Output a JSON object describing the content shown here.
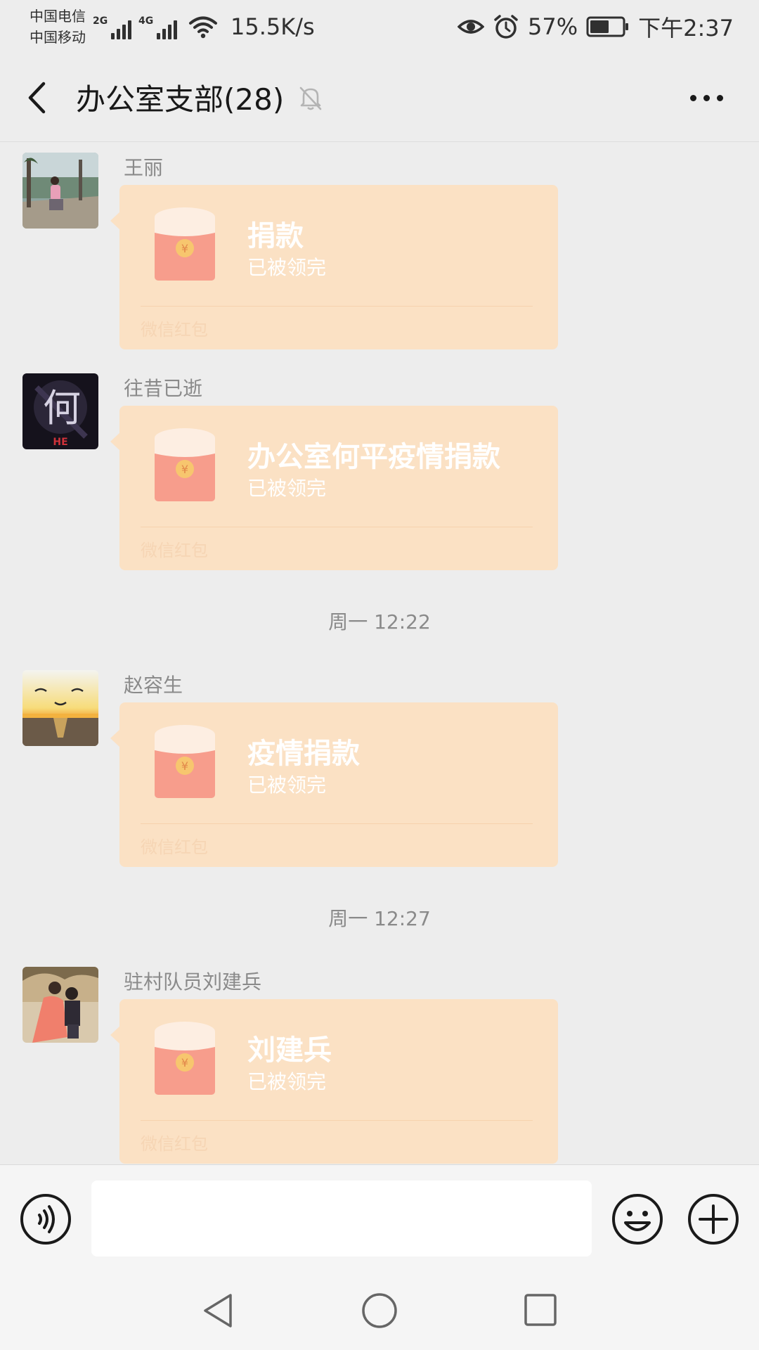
{
  "status_bar": {
    "carrier_1": "中国电信",
    "carrier_2": "中国移动",
    "sim1_network": "2G",
    "sim2_network": "4G",
    "net_speed": "15.5K/s",
    "battery": "57%",
    "time": "下午2:37",
    "icons": [
      "signal-icon",
      "wifi-icon",
      "eye-icon",
      "alarm-icon",
      "battery-icon"
    ]
  },
  "header": {
    "title": "办公室支部(28)",
    "icons": [
      "back-arrow-icon",
      "mute-bell-icon",
      "more-dots-icon"
    ]
  },
  "messages": [
    {
      "sender": "王丽",
      "avatar": "photo-woman-by-river",
      "envelope_title": "捐款",
      "envelope_status": "已被领完",
      "envelope_footer": "微信红包"
    },
    {
      "sender": "往昔已逝",
      "avatar": "dark-he-character-logo",
      "avatar_text": "何",
      "avatar_caption": "HE",
      "envelope_title": "办公室何平疫情捐款",
      "envelope_status": "已被领完",
      "envelope_footer": "微信红包"
    },
    {
      "sender": "赵容生",
      "avatar": "sunset-sea-birds",
      "envelope_title": "疫情捐款",
      "envelope_status": "已被领完",
      "envelope_footer": "微信红包"
    },
    {
      "sender": "驻村队员刘建兵",
      "avatar": "couple-wedding-photo",
      "envelope_title": "刘建兵",
      "envelope_status": "已被领完",
      "envelope_footer": "微信红包"
    }
  ],
  "timestamps": [
    "周一 12:22",
    "周一 12:27"
  ],
  "input_bar": {
    "value": "",
    "placeholder": "",
    "icons": [
      "voice-icon",
      "emoji-icon",
      "plus-icon"
    ]
  },
  "nav_bar": {
    "icons": [
      "nav-back-icon",
      "nav-home-icon",
      "nav-recents-icon"
    ]
  },
  "colors": {
    "background": "#ededed",
    "red_packet_bubble": "#fbe1c4",
    "envelope_body": "#f79d8c",
    "envelope_flap": "#fdeee2",
    "coin": "#f7c66e"
  }
}
